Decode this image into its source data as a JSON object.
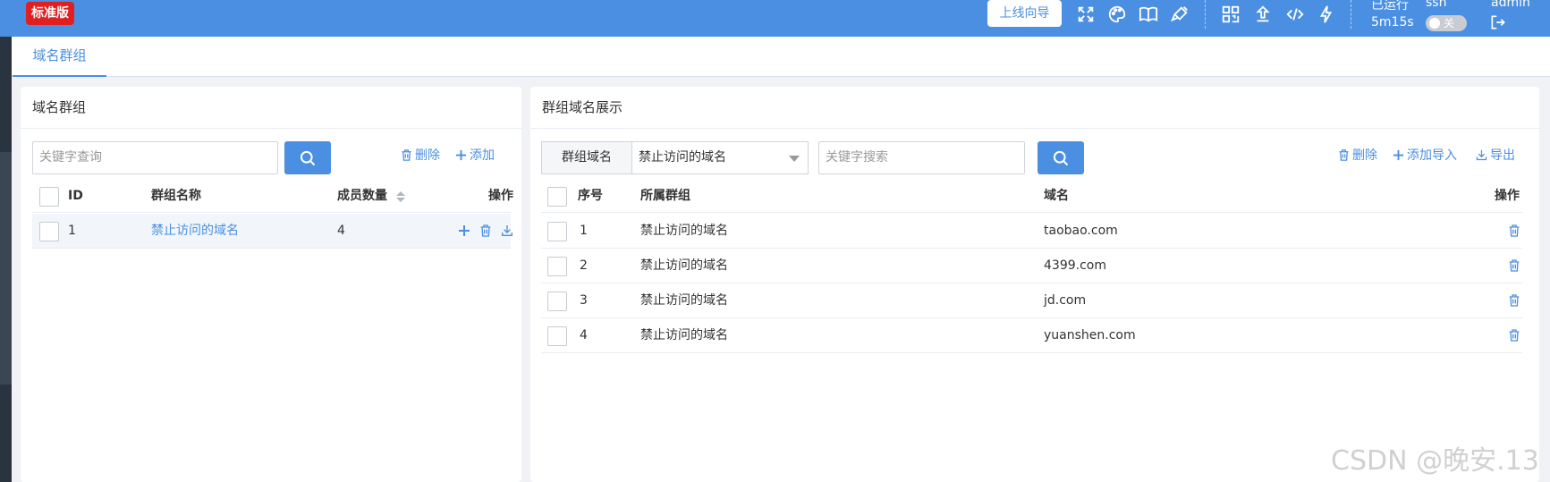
{
  "header": {
    "edition_badge": "标准版",
    "guide_button": "上线向导",
    "runtime_label": "已运行",
    "runtime_value": "5m15s",
    "ssh_label": "ssh",
    "ssh_toggle_text": "关",
    "user": "admin",
    "accent_color": "#4a8fe2",
    "badge_color": "#e02020"
  },
  "tabs": [
    {
      "label": "域名群组",
      "active": true
    }
  ],
  "left_panel": {
    "title": "域名群组",
    "search_placeholder": "关键字查询",
    "delete_label": "删除",
    "add_label": "添加",
    "columns": [
      "ID",
      "群组名称",
      "成员数量",
      "操作"
    ],
    "rows": [
      {
        "id": "1",
        "name": "禁止访问的域名",
        "count": "4"
      }
    ]
  },
  "right_panel": {
    "title": "群组域名展示",
    "group_select_label": "群组域名",
    "group_select_value": "禁止访问的域名",
    "search_placeholder": "关键字搜索",
    "delete_label": "删除",
    "import_label": "添加导入",
    "export_label": "导出",
    "columns": [
      "序号",
      "所属群组",
      "域名",
      "操作"
    ],
    "rows": [
      {
        "seq": "1",
        "group": "禁止访问的域名",
        "domain": "taobao.com"
      },
      {
        "seq": "2",
        "group": "禁止访问的域名",
        "domain": "4399.com"
      },
      {
        "seq": "3",
        "group": "禁止访问的域名",
        "domain": "jd.com"
      },
      {
        "seq": "4",
        "group": "禁止访问的域名",
        "domain": "yuanshen.com"
      }
    ]
  },
  "watermark": "CSDN @晚安.13"
}
